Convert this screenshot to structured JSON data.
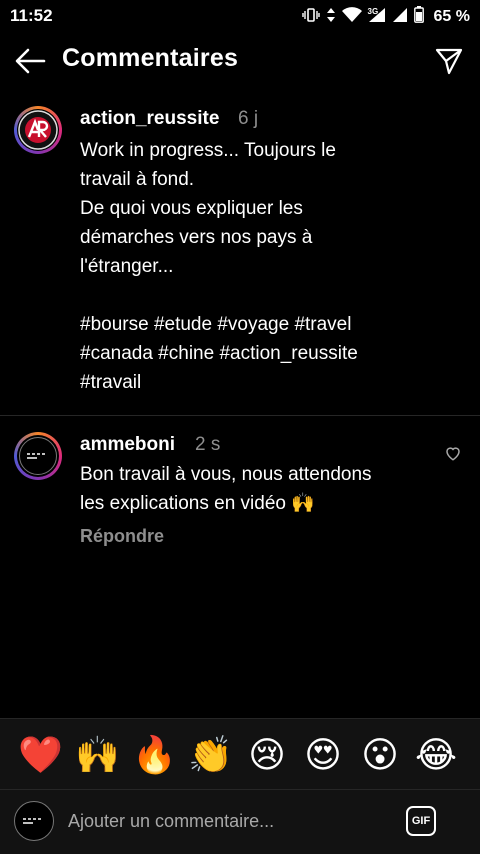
{
  "status_bar": {
    "time": "11:52",
    "battery_pct": "65 %",
    "icons": [
      "vibrate-icon",
      "data-arrows-icon",
      "wifi-icon",
      "signal-3g-icon",
      "signal-icon",
      "battery-icon"
    ],
    "network_label": "3G"
  },
  "header": {
    "title": "Commentaires",
    "back_icon": "back-arrow-icon",
    "send_icon": "send-icon"
  },
  "caption": {
    "username": "action_reussite",
    "time": "6 j",
    "lines": [
      "Work in progress... Toujours le",
      "travail à fond.",
      "De quoi vous expliquer les",
      "démarches vers nos pays à",
      "l'étranger...",
      "",
      "#bourse #etude #voyage #travel",
      "#canada #chine #action_reussite",
      "#travail"
    ]
  },
  "comment": {
    "username": "ammeboni",
    "time": "2 s",
    "lines": [
      "Bon travail à vous, nous attendons",
      "les explications en vidéo 🙌"
    ],
    "reply_label": "Répondre"
  },
  "emoji_bar": [
    "❤️",
    "🙌",
    "🔥",
    "👏",
    "😢",
    "😍",
    "😮",
    "😂"
  ],
  "composer": {
    "placeholder": "Ajouter un commentaire...",
    "gif_label": "GIF"
  },
  "colors": {
    "background": "#000000",
    "secondary_text": "#8e8e8e",
    "heart_red": "#ed4956"
  }
}
